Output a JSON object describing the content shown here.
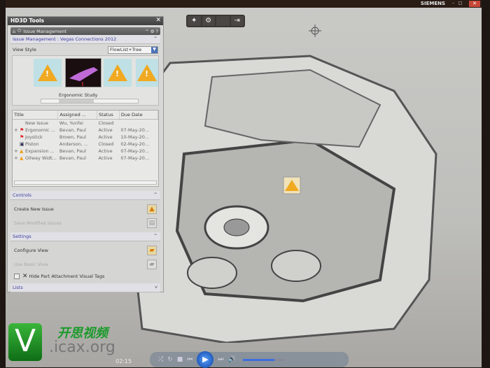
{
  "top_bar": {
    "brand": "SIEMENS",
    "minimize": "–",
    "maximize": "□",
    "close": "✕"
  },
  "toolbar": {
    "items": [
      "✦",
      "⚙",
      "",
      "⇥"
    ]
  },
  "panel": {
    "title": "HD3D Tools",
    "close": "✕",
    "nav": {
      "home": "⌂",
      "back": "⏻",
      "label": "Issue Management",
      "up": "^",
      "settings": "⚙",
      "help": "?"
    },
    "issue_section": {
      "label": "Issue Management : Vegas Connections 2012",
      "chevron": "^"
    },
    "view_style": {
      "label": "View Style",
      "value": "FlowList+Tree"
    },
    "gallery": {
      "caption": "Ergonomic Study",
      "badge": "1"
    },
    "table": {
      "columns": [
        "Title",
        "Assigned ...",
        "Status",
        "Due Date"
      ],
      "rows": [
        {
          "expand": "",
          "icon": "",
          "title": "New Issue",
          "assigned": "Wu, Yunfei",
          "status": "Closed",
          "due": ""
        },
        {
          "expand": "+",
          "icon": "flag",
          "title": "Ergonomic ...",
          "assigned": "Bevan, Paul",
          "status": "Active",
          "due": "07-May-20..."
        },
        {
          "expand": "",
          "icon": "flag",
          "title": "Joystick",
          "assigned": "Brown, Paul",
          "status": "Active",
          "due": "10-May-20..."
        },
        {
          "expand": "",
          "icon": "image",
          "title": "Piston",
          "assigned": "Anderson, ...",
          "status": "Closed",
          "due": "02-May-20..."
        },
        {
          "expand": "+",
          "icon": "warning",
          "title": "Expansion ...",
          "assigned": "Bevan, Paul",
          "status": "Active",
          "due": "07-May-20..."
        },
        {
          "expand": "+",
          "icon": "warning",
          "title": "Oilway Widt...",
          "assigned": "Bevan, Paul",
          "status": "Active",
          "due": "07-May-20..."
        }
      ]
    },
    "controls": {
      "label": "Controls",
      "chevron": "^",
      "create": "Create New Issue",
      "save": "Save Modified Issues"
    },
    "settings": {
      "label": "Settings",
      "chevron": "^",
      "configure": "Configure View",
      "basic": "Use Basic View",
      "hide_tags": "Hide Part Attachment Visual Tags"
    },
    "lists": {
      "label": "Lists",
      "chevron": "v"
    }
  },
  "watermark": {
    "chinese": "开思视频",
    "url": ".icax.org",
    "logo_letter": "V"
  },
  "player": {
    "time": "02:15",
    "controls": [
      "⤮",
      "↻",
      "■",
      "⏮",
      "▶",
      "⏭",
      "🔊"
    ],
    "volume": 0.75
  }
}
